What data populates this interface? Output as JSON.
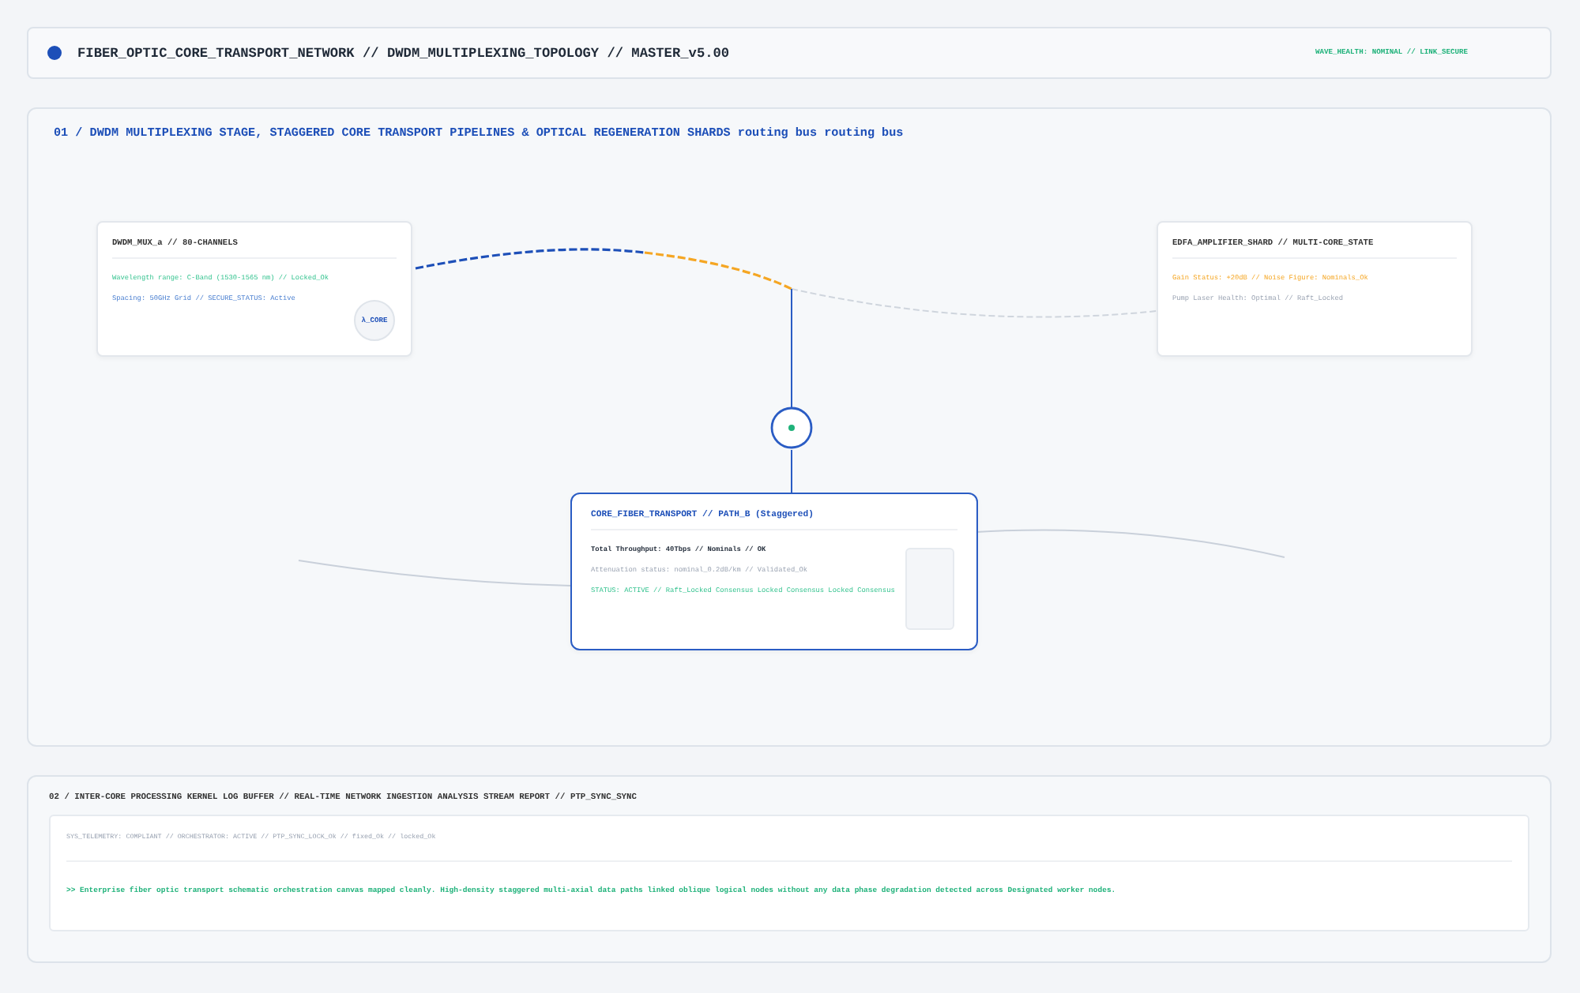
{
  "header": {
    "title": "FIBER_OPTIC_CORE_TRANSPORT_NETWORK // DWDM_MULTIPLEXING_TOPOLOGY // MASTER_v5.00",
    "status": "WAVE_HEALTH: NOMINAL // LINK_SECURE"
  },
  "topology": {
    "title": "01 / DWDM MULTIPLEXING STAGE, STAGGERED CORE TRANSPORT PIPELINES & OPTICAL REGENERATION SHARDS routing bus routing bus",
    "nodes": [
      {
        "title": "DWDM_MUX_a // 80-CHANNELS",
        "selected": false,
        "badge": "λ_CORE",
        "lines": [
          {
            "text": "Wavelength range: C-Band (1530-1565 nm) // Locked_Ok",
            "kind": "ok"
          },
          {
            "text": "Spacing: 50GHz Grid // SECURE_STATUS: Active",
            "kind": "info"
          }
        ]
      },
      {
        "title": "EDFA_AMPLIFIER_SHARD // MULTI-CORE_STATE",
        "selected": false,
        "lines": [
          {
            "text": "Gain Status: +20dB // Noise Figure: Nominals_Ok",
            "kind": "warn"
          },
          {
            "text": "Pump Laser Health: Optimal // Raft_Locked",
            "kind": "muted"
          }
        ]
      },
      {
        "title": "CORE_FIBER_TRANSPORT // PATH_B (Staggered)",
        "selected": true,
        "lines": [
          {
            "text": "Total Throughput: 40Tbps // Nominals // OK",
            "kind": "strong"
          },
          {
            "text": "Attenuation status: nominal_0.2dB/km // Validated_Ok",
            "kind": "muted"
          },
          {
            "text": "STATUS: ACTIVE // Raft_Locked Consensus Locked Consensus Locked Consensus",
            "kind": "ok"
          }
        ]
      }
    ]
  },
  "log": {
    "title": "02 / INTER-CORE PROCESSING KERNEL LOG BUFFER // REAL-TIME NETWORK INGESTION ANALYSIS STREAM REPORT // PTP_SYNC_SYNC",
    "telemetry": "SYS_TELEMETRY: COMPLIANT // ORCHESTRATOR: ACTIVE // PTP_SYNC_LOCK_Ok // fixed_Ok // locked_Ok",
    "message": ">> Enterprise fiber optic transport schematic orchestration canvas mapped cleanly. High-density staggered multi-axial data paths linked oblique logical nodes without any data phase degradation detected across Designated worker nodes."
  }
}
